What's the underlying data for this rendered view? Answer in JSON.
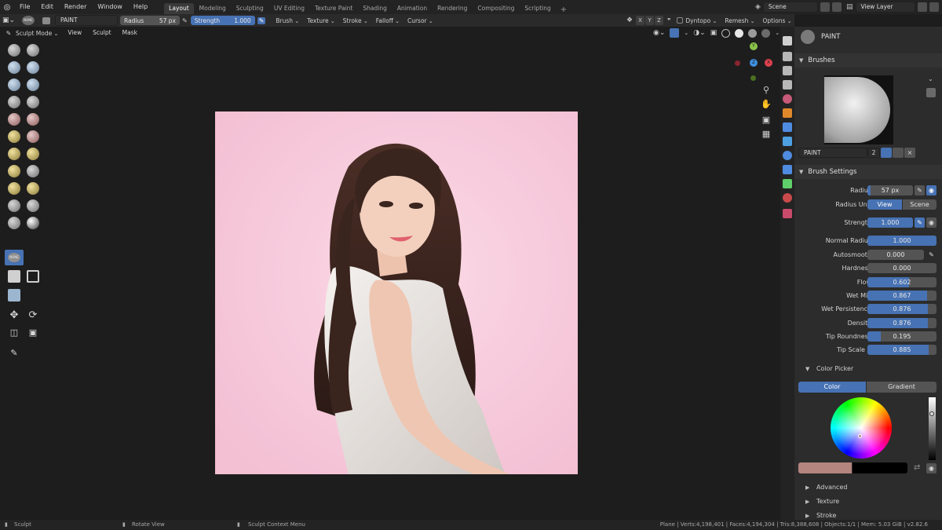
{
  "menu": {
    "items": [
      "File",
      "Edit",
      "Render",
      "Window",
      "Help"
    ]
  },
  "workspaces": {
    "tabs": [
      "Layout",
      "Modeling",
      "Sculpting",
      "UV Editing",
      "Texture Paint",
      "Shading",
      "Animation",
      "Rendering",
      "Compositing",
      "Scripting"
    ],
    "active": "Layout",
    "add_label": "+"
  },
  "scene": {
    "name": "Scene"
  },
  "view_layer": {
    "name": "View Layer"
  },
  "tool_header": {
    "brush_name": "PAINT",
    "radius_label": "Radius",
    "radius_value": "57 px",
    "strength_label": "Strength",
    "strength_value": "1.000",
    "menus": [
      "Brush",
      "Texture",
      "Stroke",
      "Falloff",
      "Cursor"
    ],
    "axes": [
      "X",
      "Y",
      "Z"
    ],
    "dyntopo_label": "Dyntopo",
    "remesh_label": "Remesh",
    "options_label": "Options"
  },
  "mode_header": {
    "mode": "Sculpt Mode",
    "menus": [
      "View",
      "Sculpt",
      "Mask"
    ]
  },
  "brush_badge": "NONE",
  "gizmo": {
    "y": "Y",
    "x": "X",
    "z": "Z"
  },
  "properties": {
    "header_brush": "PAINT",
    "brushes_title": "Brushes",
    "brush_name": "PAINT",
    "brush_users": "2",
    "brush_settings_title": "Brush Settings",
    "radius": {
      "label": "Radius",
      "value": "57 px"
    },
    "radius_unit": {
      "label": "Radius Unit",
      "options": [
        "View",
        "Scene"
      ],
      "selected": "View"
    },
    "strength": {
      "label": "Strength",
      "value": "1.000"
    },
    "sliders": [
      {
        "label": "Normal Radius",
        "value": "1.000",
        "fraction": 1.0
      },
      {
        "label": "Autosmooth",
        "value": "0.000",
        "fraction": 0.0
      },
      {
        "label": "Hardness",
        "value": "0.000",
        "fraction": 0.0
      },
      {
        "label": "Flow",
        "value": "0.602",
        "fraction": 0.602
      },
      {
        "label": "Wet Mix",
        "value": "0.867",
        "fraction": 0.867
      },
      {
        "label": "Wet Persistence",
        "value": "0.876",
        "fraction": 0.876
      },
      {
        "label": "Density",
        "value": "0.876",
        "fraction": 0.876
      },
      {
        "label": "Tip Roundness",
        "value": "0.195",
        "fraction": 0.195
      },
      {
        "label": "Tip Scale X",
        "value": "0.885",
        "fraction": 0.885
      }
    ],
    "color_picker_title": "Color Picker",
    "color_tabs": [
      "Color",
      "Gradient"
    ],
    "color_tab_selected": "Color",
    "primary_color": "#b4847e",
    "secondary_color": "#000000",
    "collapsed": [
      "Advanced",
      "Texture",
      "Stroke"
    ]
  },
  "status": {
    "left": "Sculpt",
    "middle": "Rotate View",
    "context": "Sculpt Context Menu",
    "stats": "Plane | Verts:4,198,401 | Faces:4,194,304 | Tris:8,388,608 | Objects:1/1 | Mem: 5.03 GiB | v2.82.6"
  }
}
